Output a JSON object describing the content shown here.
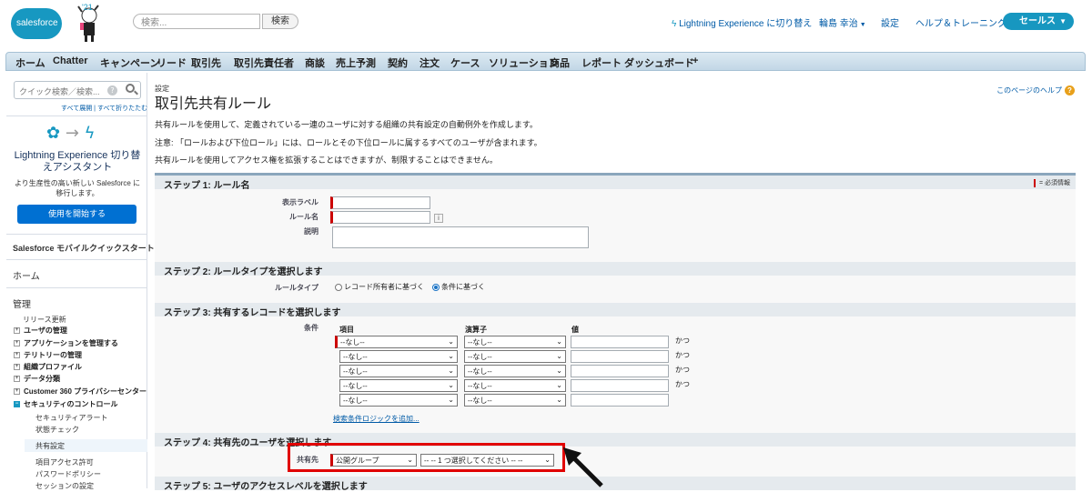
{
  "header": {
    "logo_text": "salesforce",
    "logo_year": "'21",
    "search_placeholder": "検索...",
    "search_button": "検索",
    "lightning_switch": "Lightning Experience に切り替え",
    "user_name": "輪島 幸治",
    "setup": "設定",
    "help_training": "ヘルプ＆トレーニング",
    "app_name": "セールス"
  },
  "tabs": [
    "ホーム",
    "Chatter",
    "キャンペーン",
    "リード",
    "取引先",
    "取引先責任者",
    "商談",
    "売上予測",
    "契約",
    "注文",
    "ケース",
    "ソリューション",
    "商品",
    "レポート",
    "ダッシュボード",
    "+"
  ],
  "sidebar": {
    "quick_search_placeholder": "クイック検索／検索...",
    "help_glyph": "?",
    "expand_collapse": "すべて展開 | すべて折りたたむ",
    "lightning_title": "Lightning Experience 切り替えアシスタント",
    "lightning_sub": "より生産性の高い新しい Salesforce に移行します。",
    "lightning_button": "使用を開始する",
    "mobile_quickstart": "Salesforce モバイルクイックスタート",
    "home": "ホーム",
    "admin": "管理",
    "release_update": "リリース更新",
    "items": [
      "ユーザの管理",
      "アプリケーションを管理する",
      "テリトリーの管理",
      "組織プロファイル",
      "データ分類",
      "Customer 360 プライバシーセンター",
      "セキュリティのコントロール"
    ],
    "security_sub": [
      "セキュリティアラート",
      "状態チェック",
      "共有設定",
      "項目アクセス許可",
      "パスワードポリシー",
      "セッションの設定"
    ]
  },
  "main": {
    "breadcrumb": "設定",
    "title": "取引先共有ルール",
    "help_link": "このページのヘルプ",
    "help_glyph": "?",
    "desc1": "共有ルールを使用して、定義されている一連のユーザに対する組織の共有設定の自動例外を作成します。",
    "desc2": "注意: 「ロールおよび下位ロール」には、ロールとその下位ロールに属するすべてのユーザが含まれます。",
    "desc3": "共有ルールを使用してアクセス権を拡張することはできますが、制限することはできません。",
    "step1": "ステップ 1: ルール名",
    "required_info": "= 必須情報",
    "label_display": "表示ラベル",
    "label_rule_name": "ルール名",
    "label_description": "説明",
    "info_glyph": "i",
    "step2": "ステップ 2: ルールタイプを選択します",
    "label_rule_type": "ルールタイプ",
    "rule_type_owner": "レコード所有者に基づく",
    "rule_type_criteria": "条件に基づく",
    "step3": "ステップ 3: 共有するレコードを選択します",
    "label_criteria": "条件",
    "col_field": "項目",
    "col_operator": "演算子",
    "col_value": "値",
    "none_option": "--なし--",
    "and_label": "かつ",
    "add_logic": "検索条件ロジックを追加...",
    "step4": "ステップ 4: 共有先のユーザを選択します",
    "label_share_with": "共有先",
    "share_type": "公開グループ",
    "share_target": "-- -- 1 つ選択してください -- --",
    "step5": "ステップ 5: ユーザのアクセスレベルを選択します"
  }
}
